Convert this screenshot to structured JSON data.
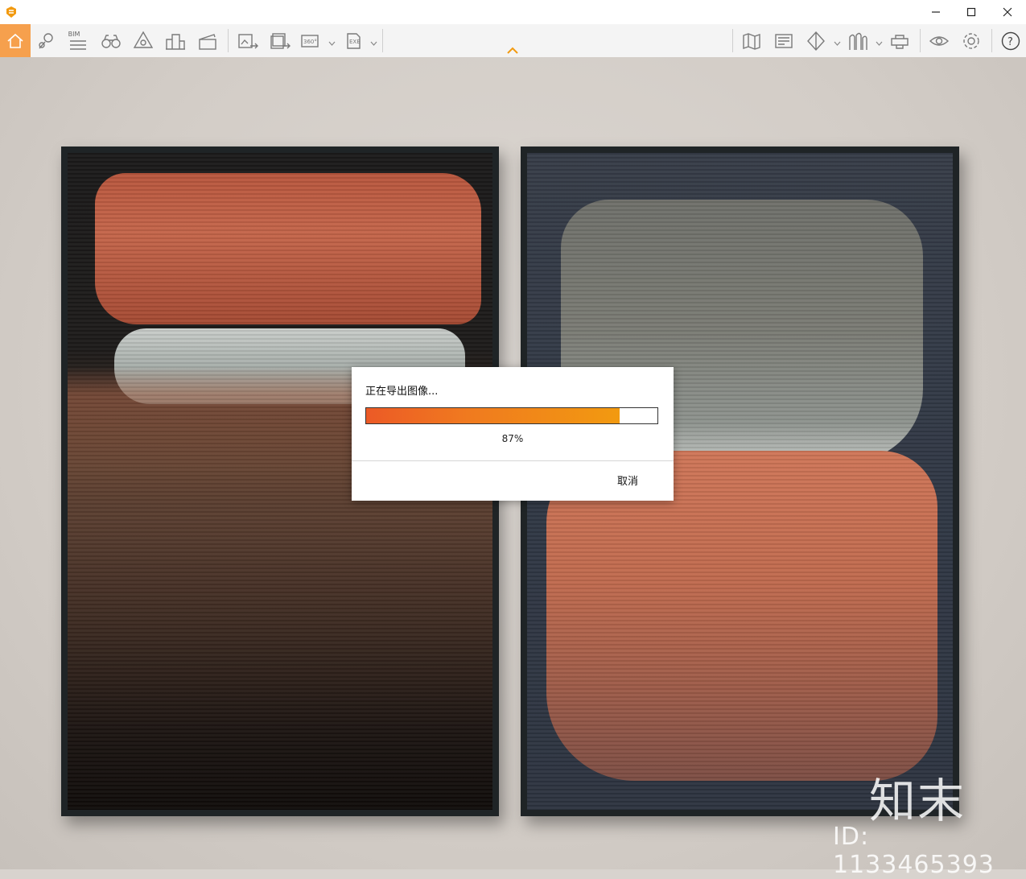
{
  "titlebar": {
    "app_logo": "app-logo-icon",
    "window_controls": [
      "minimize-icon",
      "maximize-icon",
      "close-icon"
    ]
  },
  "toolbar": {
    "bim_label": "BIM",
    "pano_label": "360°",
    "exe_label": "EXE",
    "icons": [
      "home-icon",
      "location-pin-icon",
      "bim-icon",
      "binoculars-icon",
      "camera-icon",
      "building-icon",
      "clapper-icon",
      "export-image-icon",
      "export-batch-icon",
      "export-360-icon",
      "export-exe-icon",
      "map-icon",
      "gallery-icon",
      "section-icon",
      "people-icon",
      "vr-icon",
      "eye-icon",
      "gear-icon",
      "help-icon"
    ],
    "accent": "#f6a04d"
  },
  "dialog": {
    "title": "正在导出图像...",
    "progress": 0.87,
    "percent_label": "87%",
    "cancel_label": "取消",
    "progress_colors": [
      "#ec5a26",
      "#f29a10"
    ]
  },
  "watermark": {
    "brand": "知末",
    "id_text": "ID: 1133465393"
  }
}
